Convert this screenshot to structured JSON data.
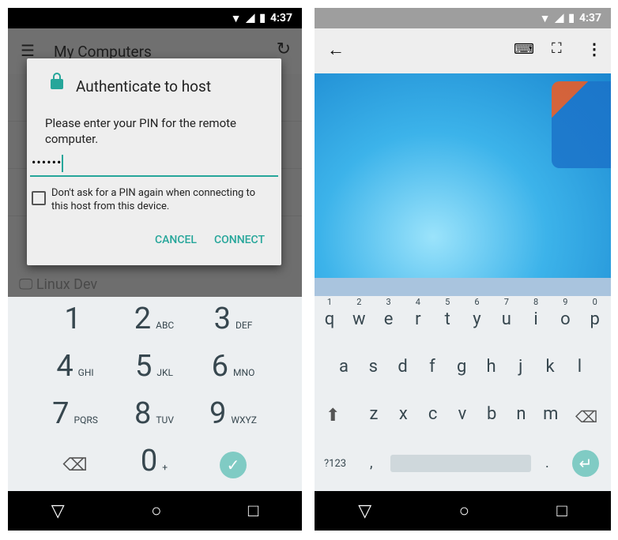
{
  "status": {
    "time": "4:37",
    "icons": [
      "wifi-icon",
      "signal-icon",
      "battery-icon"
    ]
  },
  "left": {
    "app_title": "My Computers",
    "list_items": [
      "Linux Dev"
    ],
    "dialog": {
      "title": "Authenticate to host",
      "message": "Please enter your PIN for the remote computer.",
      "pin_value": "••••••",
      "checkbox_label": "Don't ask for a PIN again when connecting to this host from this device.",
      "checkbox_checked": false,
      "cancel": "CANCEL",
      "connect": "CONNECT"
    },
    "keypad": [
      {
        "d": "1",
        "l": ""
      },
      {
        "d": "2",
        "l": "ABC"
      },
      {
        "d": "3",
        "l": "DEF"
      },
      {
        "d": "4",
        "l": "GHI"
      },
      {
        "d": "5",
        "l": "JKL"
      },
      {
        "d": "6",
        "l": "MNO"
      },
      {
        "d": "7",
        "l": "PQRS"
      },
      {
        "d": "8",
        "l": "TUV"
      },
      {
        "d": "9",
        "l": "WXYZ"
      },
      {
        "d": "⌫",
        "l": ""
      },
      {
        "d": "0",
        "l": "+"
      },
      {
        "d": "✓",
        "l": ""
      }
    ],
    "accent": "#26a69a"
  },
  "right": {
    "toolbar_icons": [
      "back-arrow-icon",
      "keyboard-icon",
      "fullscreen-icon",
      "more-vert-icon"
    ],
    "row1": [
      "q",
      "w",
      "e",
      "r",
      "t",
      "y",
      "u",
      "i",
      "o",
      "p"
    ],
    "row1_digits": [
      "1",
      "2",
      "3",
      "4",
      "5",
      "6",
      "7",
      "8",
      "9",
      "0"
    ],
    "row2": [
      "a",
      "s",
      "d",
      "f",
      "g",
      "h",
      "j",
      "k",
      "l"
    ],
    "row3": [
      "z",
      "x",
      "c",
      "v",
      "b",
      "n",
      "m"
    ],
    "symbols_key": "?123",
    "comma": ",",
    "period": "."
  }
}
